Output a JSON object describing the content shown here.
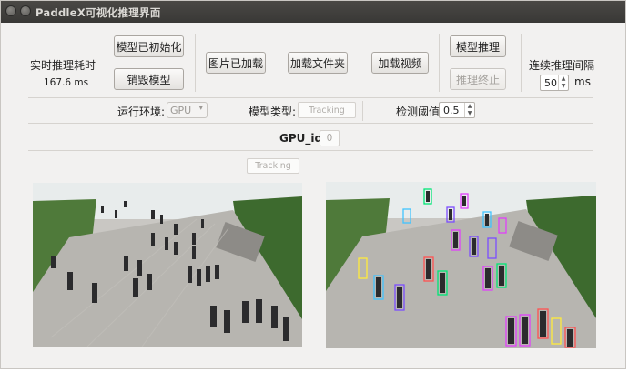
{
  "window": {
    "title": "PaddleX可视化推理界面"
  },
  "toolbar": {
    "latency_label": "实时推理耗时",
    "latency_value": "167.6 ms",
    "model_initialized": "模型已初始化",
    "destroy_model": "销毁模型",
    "image_loaded": "图片已加载",
    "load_folder": "加载文件夹",
    "load_video": "加载视频",
    "model_infer": "模型推理",
    "stop_infer": "推理终止",
    "interval_label": "连续推理间隔",
    "interval_value": "50",
    "interval_unit": "ms"
  },
  "settings": {
    "env_label": "运行环境:",
    "env_value": "GPU",
    "model_type_label": "模型类型:",
    "model_type_value": "Tracking",
    "threshold_label": "检测阈值",
    "threshold_value": "0.5",
    "gpu_id_label": "GPU_id",
    "gpu_id_value": "0",
    "task_value": "Tracking"
  },
  "images": {
    "left": "input-image",
    "right": "tracking-result-image"
  },
  "colors": {
    "titlebar": "#3f3e3c",
    "window_bg": "#f2f1f0",
    "box_colors": [
      "#e040fb",
      "#7c4dff",
      "#00e676",
      "#ff5252",
      "#ffeb3b",
      "#40c4ff"
    ]
  }
}
